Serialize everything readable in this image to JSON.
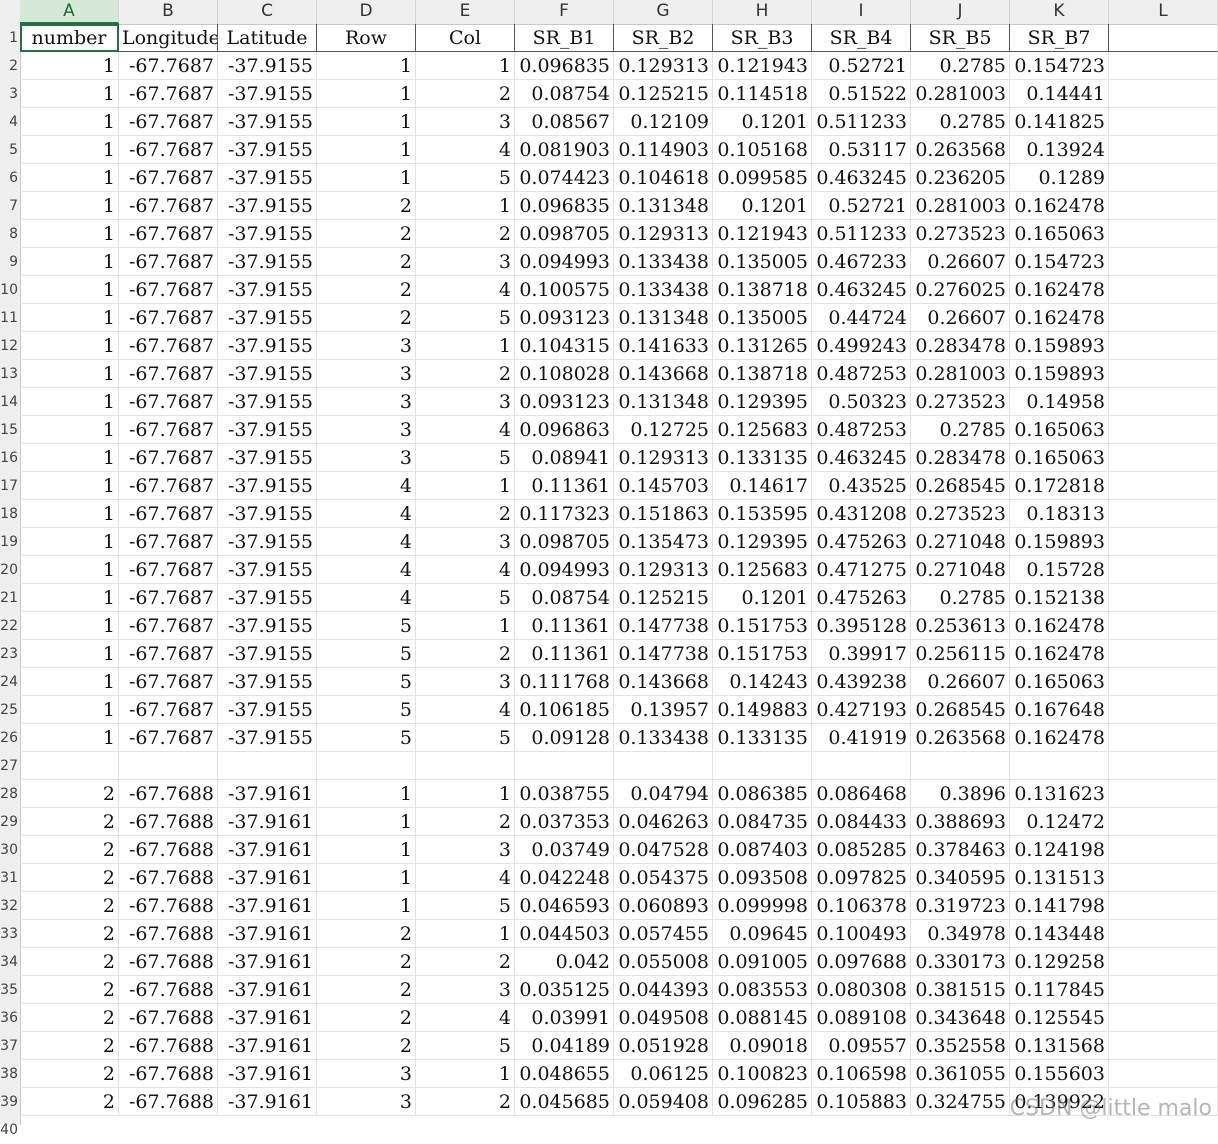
{
  "columns": [
    "A",
    "B",
    "C",
    "D",
    "E",
    "F",
    "G",
    "H",
    "I",
    "J",
    "K",
    "L"
  ],
  "active_column": "A",
  "row_numbers": [
    "1",
    "2",
    "3",
    "4",
    "5",
    "6",
    "7",
    "8",
    "9",
    "10",
    "11",
    "12",
    "13",
    "14",
    "15",
    "16",
    "17",
    "18",
    "19",
    "20",
    "21",
    "22",
    "23",
    "24",
    "25",
    "26",
    "27",
    "28",
    "29",
    "30",
    "31",
    "32",
    "33",
    "34",
    "35",
    "36",
    "37",
    "38",
    "39",
    "40"
  ],
  "header": [
    "number",
    "Longitude",
    "Latitude",
    "Row",
    "Col",
    "SR_B1",
    "SR_B2",
    "SR_B3",
    "SR_B4",
    "SR_B5",
    "SR_B7"
  ],
  "rows": [
    [
      "1",
      "-67.7687",
      "-37.9155",
      "1",
      "1",
      "0.096835",
      "0.129313",
      "0.121943",
      "0.52721",
      "0.2785",
      "0.154723"
    ],
    [
      "1",
      "-67.7687",
      "-37.9155",
      "1",
      "2",
      "0.08754",
      "0.125215",
      "0.114518",
      "0.51522",
      "0.281003",
      "0.14441"
    ],
    [
      "1",
      "-67.7687",
      "-37.9155",
      "1",
      "3",
      "0.08567",
      "0.12109",
      "0.1201",
      "0.511233",
      "0.2785",
      "0.141825"
    ],
    [
      "1",
      "-67.7687",
      "-37.9155",
      "1",
      "4",
      "0.081903",
      "0.114903",
      "0.105168",
      "0.53117",
      "0.263568",
      "0.13924"
    ],
    [
      "1",
      "-67.7687",
      "-37.9155",
      "1",
      "5",
      "0.074423",
      "0.104618",
      "0.099585",
      "0.463245",
      "0.236205",
      "0.1289"
    ],
    [
      "1",
      "-67.7687",
      "-37.9155",
      "2",
      "1",
      "0.096835",
      "0.131348",
      "0.1201",
      "0.52721",
      "0.281003",
      "0.162478"
    ],
    [
      "1",
      "-67.7687",
      "-37.9155",
      "2",
      "2",
      "0.098705",
      "0.129313",
      "0.121943",
      "0.511233",
      "0.273523",
      "0.165063"
    ],
    [
      "1",
      "-67.7687",
      "-37.9155",
      "2",
      "3",
      "0.094993",
      "0.133438",
      "0.135005",
      "0.467233",
      "0.26607",
      "0.154723"
    ],
    [
      "1",
      "-67.7687",
      "-37.9155",
      "2",
      "4",
      "0.100575",
      "0.133438",
      "0.138718",
      "0.463245",
      "0.276025",
      "0.162478"
    ],
    [
      "1",
      "-67.7687",
      "-37.9155",
      "2",
      "5",
      "0.093123",
      "0.131348",
      "0.135005",
      "0.44724",
      "0.26607",
      "0.162478"
    ],
    [
      "1",
      "-67.7687",
      "-37.9155",
      "3",
      "1",
      "0.104315",
      "0.141633",
      "0.131265",
      "0.499243",
      "0.283478",
      "0.159893"
    ],
    [
      "1",
      "-67.7687",
      "-37.9155",
      "3",
      "2",
      "0.108028",
      "0.143668",
      "0.138718",
      "0.487253",
      "0.281003",
      "0.159893"
    ],
    [
      "1",
      "-67.7687",
      "-37.9155",
      "3",
      "3",
      "0.093123",
      "0.131348",
      "0.129395",
      "0.50323",
      "0.273523",
      "0.14958"
    ],
    [
      "1",
      "-67.7687",
      "-37.9155",
      "3",
      "4",
      "0.096863",
      "0.12725",
      "0.125683",
      "0.487253",
      "0.2785",
      "0.165063"
    ],
    [
      "1",
      "-67.7687",
      "-37.9155",
      "3",
      "5",
      "0.08941",
      "0.129313",
      "0.133135",
      "0.463245",
      "0.283478",
      "0.165063"
    ],
    [
      "1",
      "-67.7687",
      "-37.9155",
      "4",
      "1",
      "0.11361",
      "0.145703",
      "0.14617",
      "0.43525",
      "0.268545",
      "0.172818"
    ],
    [
      "1",
      "-67.7687",
      "-37.9155",
      "4",
      "2",
      "0.117323",
      "0.151863",
      "0.153595",
      "0.431208",
      "0.273523",
      "0.18313"
    ],
    [
      "1",
      "-67.7687",
      "-37.9155",
      "4",
      "3",
      "0.098705",
      "0.135473",
      "0.129395",
      "0.475263",
      "0.271048",
      "0.159893"
    ],
    [
      "1",
      "-67.7687",
      "-37.9155",
      "4",
      "4",
      "0.094993",
      "0.129313",
      "0.125683",
      "0.471275",
      "0.271048",
      "0.15728"
    ],
    [
      "1",
      "-67.7687",
      "-37.9155",
      "4",
      "5",
      "0.08754",
      "0.125215",
      "0.1201",
      "0.475263",
      "0.2785",
      "0.152138"
    ],
    [
      "1",
      "-67.7687",
      "-37.9155",
      "5",
      "1",
      "0.11361",
      "0.147738",
      "0.151753",
      "0.395128",
      "0.253613",
      "0.162478"
    ],
    [
      "1",
      "-67.7687",
      "-37.9155",
      "5",
      "2",
      "0.11361",
      "0.147738",
      "0.151753",
      "0.39917",
      "0.256115",
      "0.162478"
    ],
    [
      "1",
      "-67.7687",
      "-37.9155",
      "5",
      "3",
      "0.111768",
      "0.143668",
      "0.14243",
      "0.439238",
      "0.26607",
      "0.165063"
    ],
    [
      "1",
      "-67.7687",
      "-37.9155",
      "5",
      "4",
      "0.106185",
      "0.13957",
      "0.149883",
      "0.427193",
      "0.268545",
      "0.167648"
    ],
    [
      "1",
      "-67.7687",
      "-37.9155",
      "5",
      "5",
      "0.09128",
      "0.133438",
      "0.133135",
      "0.41919",
      "0.263568",
      "0.162478"
    ],
    [
      "",
      "",
      "",
      "",
      "",
      "",
      "",
      "",
      "",
      "",
      ""
    ],
    [
      "2",
      "-67.7688",
      "-37.9161",
      "1",
      "1",
      "0.038755",
      "0.04794",
      "0.086385",
      "0.086468",
      "0.3896",
      "0.131623"
    ],
    [
      "2",
      "-67.7688",
      "-37.9161",
      "1",
      "2",
      "0.037353",
      "0.046263",
      "0.084735",
      "0.084433",
      "0.388693",
      "0.12472"
    ],
    [
      "2",
      "-67.7688",
      "-37.9161",
      "1",
      "3",
      "0.03749",
      "0.047528",
      "0.087403",
      "0.085285",
      "0.378463",
      "0.124198"
    ],
    [
      "2",
      "-67.7688",
      "-37.9161",
      "1",
      "4",
      "0.042248",
      "0.054375",
      "0.093508",
      "0.097825",
      "0.340595",
      "0.131513"
    ],
    [
      "2",
      "-67.7688",
      "-37.9161",
      "1",
      "5",
      "0.046593",
      "0.060893",
      "0.099998",
      "0.106378",
      "0.319723",
      "0.141798"
    ],
    [
      "2",
      "-67.7688",
      "-37.9161",
      "2",
      "1",
      "0.044503",
      "0.057455",
      "0.09645",
      "0.100493",
      "0.34978",
      "0.143448"
    ],
    [
      "2",
      "-67.7688",
      "-37.9161",
      "2",
      "2",
      "0.042",
      "0.055008",
      "0.091005",
      "0.097688",
      "0.330173",
      "0.129258"
    ],
    [
      "2",
      "-67.7688",
      "-37.9161",
      "2",
      "3",
      "0.035125",
      "0.044393",
      "0.083553",
      "0.080308",
      "0.381515",
      "0.117845"
    ],
    [
      "2",
      "-67.7688",
      "-37.9161",
      "2",
      "4",
      "0.03991",
      "0.049508",
      "0.088145",
      "0.089108",
      "0.343648",
      "0.125545"
    ],
    [
      "2",
      "-67.7688",
      "-37.9161",
      "2",
      "5",
      "0.04189",
      "0.051928",
      "0.09018",
      "0.09557",
      "0.352558",
      "0.131568"
    ],
    [
      "2",
      "-67.7688",
      "-37.9161",
      "3",
      "1",
      "0.048655",
      "0.06125",
      "0.100823",
      "0.106598",
      "0.361055",
      "0.155603"
    ],
    [
      "2",
      "-67.7688",
      "-37.9161",
      "3",
      "2",
      "0.045685",
      "0.059408",
      "0.096285",
      "0.105883",
      "0.324755",
      "0.139922"
    ]
  ],
  "watermark": "CSDN @little malo",
  "colors": {
    "selection": "#217346",
    "header_bg": "#efefef"
  }
}
